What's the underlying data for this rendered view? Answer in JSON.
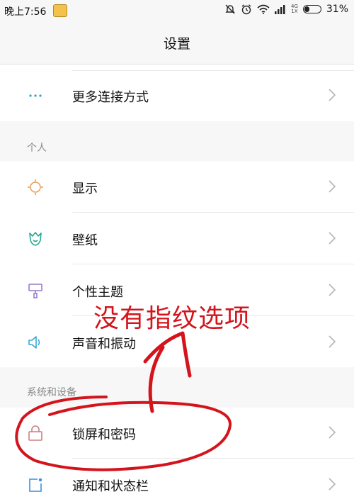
{
  "status_bar": {
    "time": "晚上7:56",
    "network_top": "4G",
    "network_bottom": "1X",
    "battery_percent": "31%",
    "battery_level": 0.31
  },
  "header": {
    "title": "设置"
  },
  "sections": {
    "connect": {
      "items": [
        {
          "label": "更多连接方式",
          "icon": "more-dots-icon"
        }
      ]
    },
    "personal": {
      "header": "个人",
      "items": [
        {
          "label": "显示",
          "icon": "sun-icon"
        },
        {
          "label": "壁纸",
          "icon": "tulip-icon"
        },
        {
          "label": "个性主题",
          "icon": "paint-roller-icon"
        },
        {
          "label": "声音和振动",
          "icon": "speaker-icon"
        }
      ]
    },
    "system": {
      "header": "系统和设备",
      "items": [
        {
          "label": "锁屏和密码",
          "icon": "lock-icon"
        },
        {
          "label": "通知和状态栏",
          "icon": "notification-icon"
        }
      ]
    }
  },
  "annotation": {
    "text": "没有指纹选项",
    "color": "#d4141c"
  },
  "colors": {
    "accent_blue": "#2aa5c9",
    "display_orange": "#e9a35a",
    "wallpaper_green": "#2aa790",
    "theme_purple": "#9a79c9",
    "sound_blue": "#3aa6d6",
    "lock_red": "#c98086",
    "notify_blue": "#3a8fe0"
  }
}
